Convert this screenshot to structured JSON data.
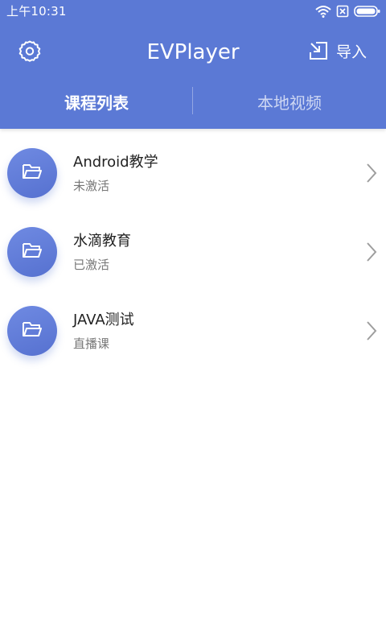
{
  "status_bar": {
    "time": "上午10:31",
    "icons": [
      "wifi-icon",
      "sim-icon",
      "battery-icon"
    ]
  },
  "app_bar": {
    "title": "EVPlayer",
    "settings_icon": "gear-icon",
    "import_icon": "import-icon",
    "import_label": "导入"
  },
  "tabs": [
    {
      "label": "课程列表",
      "active": true
    },
    {
      "label": "本地视频",
      "active": false
    }
  ],
  "courses": [
    {
      "title": "Android教学",
      "status": "未激活",
      "icon": "folder-icon"
    },
    {
      "title": "水滴教育",
      "status": "已激活",
      "icon": "folder-icon"
    },
    {
      "title": "JAVA测试",
      "status": "直播课",
      "icon": "folder-icon"
    }
  ],
  "colors": {
    "primary": "#5b79d5",
    "avatar": "#6480db",
    "title_text": "#222222",
    "sub_text": "#777777",
    "chevron": "#9e9e9e"
  }
}
